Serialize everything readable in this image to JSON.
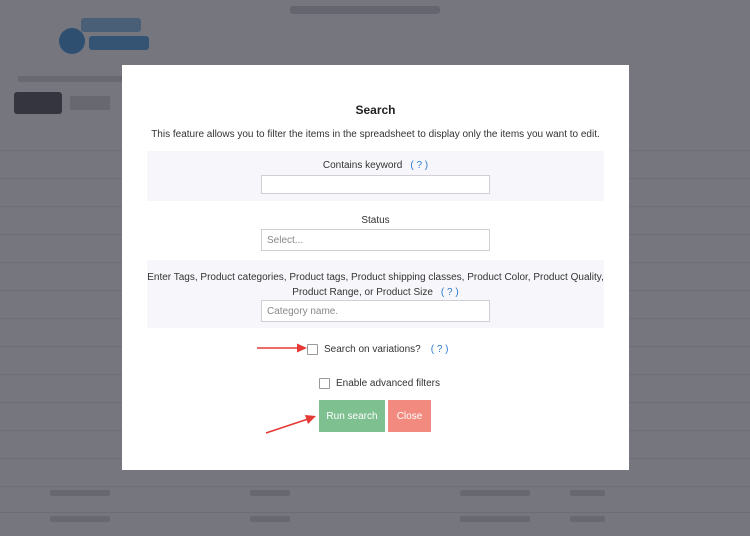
{
  "modal": {
    "title": "Search",
    "description": "This feature allows you to filter the items in the spreadsheet to display only the items you want to edit.",
    "keyword": {
      "label": "Contains keyword",
      "help": "( ? )",
      "value": ""
    },
    "status": {
      "label": "Status",
      "placeholder": "Select..."
    },
    "taxonomies": {
      "label_line1": "Enter Tags, Product categories, Product tags, Product shipping classes, Product Color, Product Quality,",
      "label_line2": "Product Range, or Product Size",
      "help": "( ? )",
      "placeholder": "Category name."
    },
    "search_variations": {
      "label": "Search on variations?",
      "help": "( ? )",
      "checked": false
    },
    "advanced_filters": {
      "label": "Enable advanced filters",
      "checked": false
    },
    "run_button": "Run search",
    "close_button": "Close"
  },
  "colors": {
    "run_button": "#7ec08f",
    "close_button": "#f28a80",
    "help_link": "#2a7bd0",
    "annotation_arrow": "#e53935"
  }
}
